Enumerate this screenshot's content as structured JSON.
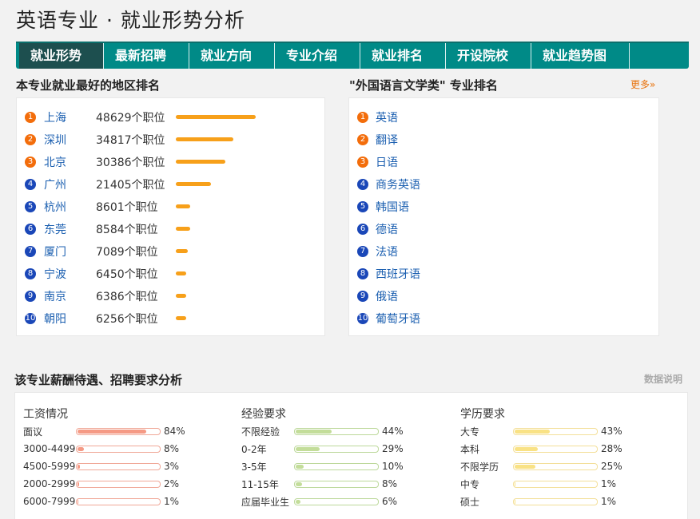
{
  "page": {
    "title": "英语专业 · 就业形势分析"
  },
  "tabs": [
    {
      "label": "就业形势"
    },
    {
      "label": "最新招聘"
    },
    {
      "label": "就业方向"
    },
    {
      "label": "专业介绍"
    },
    {
      "label": "就业排名"
    },
    {
      "label": "开设院校"
    },
    {
      "label": "就业趋势图"
    }
  ],
  "regions": {
    "heading": "本专业就业最好的地区排名",
    "max_jobs": 48629,
    "items": [
      {
        "rank": "1",
        "city": "上海",
        "jobs_text": "48629个职位",
        "jobs": 48629
      },
      {
        "rank": "2",
        "city": "深圳",
        "jobs_text": "34817个职位",
        "jobs": 34817
      },
      {
        "rank": "3",
        "city": "北京",
        "jobs_text": "30386个职位",
        "jobs": 30386
      },
      {
        "rank": "4",
        "city": "广州",
        "jobs_text": "21405个职位",
        "jobs": 21405
      },
      {
        "rank": "5",
        "city": "杭州",
        "jobs_text": "8601个职位",
        "jobs": 8601
      },
      {
        "rank": "6",
        "city": "东莞",
        "jobs_text": "8584个职位",
        "jobs": 8584
      },
      {
        "rank": "7",
        "city": "厦门",
        "jobs_text": "7089个职位",
        "jobs": 7089
      },
      {
        "rank": "8",
        "city": "宁波",
        "jobs_text": "6450个职位",
        "jobs": 6450
      },
      {
        "rank": "9",
        "city": "南京",
        "jobs_text": "6386个职位",
        "jobs": 6386
      },
      {
        "rank": "10",
        "city": "朝阳",
        "jobs_text": "6256个职位",
        "jobs": 6256
      }
    ]
  },
  "majors": {
    "heading": "\"外国语言文学类\" 专业排名",
    "more": "更多»",
    "items": [
      {
        "rank": "1",
        "name": "英语"
      },
      {
        "rank": "2",
        "name": "翻译"
      },
      {
        "rank": "3",
        "name": "日语"
      },
      {
        "rank": "4",
        "name": "商务英语"
      },
      {
        "rank": "5",
        "name": "韩国语"
      },
      {
        "rank": "6",
        "name": "德语"
      },
      {
        "rank": "7",
        "name": "法语"
      },
      {
        "rank": "8",
        "name": "西班牙语"
      },
      {
        "rank": "9",
        "name": "俄语"
      },
      {
        "rank": "10",
        "name": "葡萄牙语"
      }
    ]
  },
  "analysis": {
    "heading": "该专业薪酬待遇、招聘要求分析",
    "note": "数据说明",
    "columns": [
      {
        "title": "工资情况",
        "fill_color": "#f59a85",
        "border_color": "#f0a898",
        "rows": [
          {
            "label": "面议",
            "pct_text": "84%",
            "pct": 84
          },
          {
            "label": "3000-4499",
            "pct_text": "8%",
            "pct": 8
          },
          {
            "label": "4500-5999",
            "pct_text": "3%",
            "pct": 3
          },
          {
            "label": "2000-2999",
            "pct_text": "2%",
            "pct": 2
          },
          {
            "label": "6000-7999",
            "pct_text": "1%",
            "pct": 1
          }
        ]
      },
      {
        "title": "经验要求",
        "fill_color": "#c3dd9a",
        "border_color": "#bcd89a",
        "rows": [
          {
            "label": "不限经验",
            "pct_text": "44%",
            "pct": 44
          },
          {
            "label": "0-2年",
            "pct_text": "29%",
            "pct": 29
          },
          {
            "label": "3-5年",
            "pct_text": "10%",
            "pct": 10
          },
          {
            "label": "11-15年",
            "pct_text": "8%",
            "pct": 8
          },
          {
            "label": "应届毕业生",
            "pct_text": "6%",
            "pct": 6
          }
        ]
      },
      {
        "title": "学历要求",
        "fill_color": "#f9e285",
        "border_color": "#f3df99",
        "rows": [
          {
            "label": "大专",
            "pct_text": "43%",
            "pct": 43
          },
          {
            "label": "本科",
            "pct_text": "28%",
            "pct": 28
          },
          {
            "label": "不限学历",
            "pct_text": "25%",
            "pct": 25
          },
          {
            "label": "中专",
            "pct_text": "1%",
            "pct": 1
          },
          {
            "label": "硕士",
            "pct_text": "1%",
            "pct": 1
          }
        ]
      }
    ]
  }
}
